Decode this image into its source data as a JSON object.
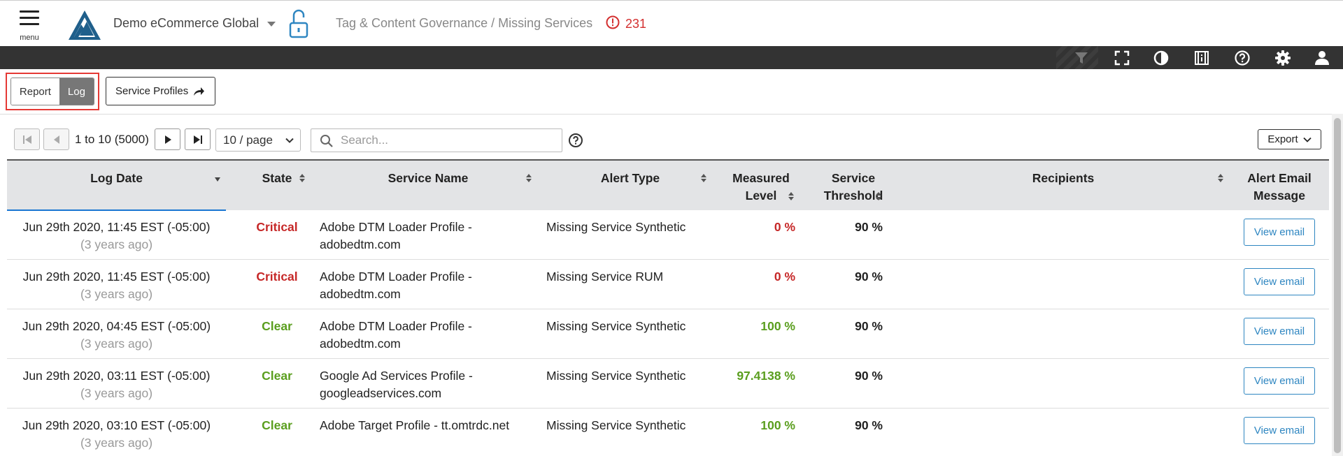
{
  "header": {
    "menu_label": "menu",
    "account_name": "Demo eCommerce Global",
    "breadcrumb": "Tag & Content Governance / Missing Services",
    "alert_count": "231"
  },
  "toolbar": {
    "icons": [
      "filter-icon",
      "fullscreen-icon",
      "contrast-icon",
      "help-manual-icon",
      "help-icon",
      "settings-icon",
      "user-icon"
    ]
  },
  "view_toggle": {
    "report_label": "Report",
    "log_label": "Log",
    "selected": "Log"
  },
  "service_profiles_label": "Service Profiles",
  "pagination": {
    "range_text": "1 to 10 (5000)",
    "per_page": "10 / page"
  },
  "search": {
    "placeholder": "Search..."
  },
  "export_label": "Export",
  "table": {
    "columns": {
      "log_date": "Log Date",
      "state": "State",
      "service_name": "Service Name",
      "alert_type": "Alert Type",
      "measured_level_1": "Measured",
      "measured_level_2": "Level",
      "service_threshold_1": "Service",
      "service_threshold_2": "Threshold",
      "recipients": "Recipients",
      "alert_email_1": "Alert Email",
      "alert_email_2": "Message"
    },
    "rows": [
      {
        "date": "Jun 29th 2020, 11:45 EST (-05:00)",
        "ago": "(3 years ago)",
        "state": "Critical",
        "name_1": "Adobe DTM Loader Profile -",
        "name_2": "adobedtm.com",
        "alert_type": "Missing Service Synthetic",
        "measured": "0 %",
        "threshold": "90 %",
        "recipients": "",
        "action": "View email"
      },
      {
        "date": "Jun 29th 2020, 11:45 EST (-05:00)",
        "ago": "(3 years ago)",
        "state": "Critical",
        "name_1": "Adobe DTM Loader Profile -",
        "name_2": "adobedtm.com",
        "alert_type": "Missing Service RUM",
        "measured": "0 %",
        "threshold": "90 %",
        "recipients": "",
        "action": "View email"
      },
      {
        "date": "Jun 29th 2020, 04:45 EST (-05:00)",
        "ago": "(3 years ago)",
        "state": "Clear",
        "name_1": "Adobe DTM Loader Profile -",
        "name_2": "adobedtm.com",
        "alert_type": "Missing Service Synthetic",
        "measured": "100 %",
        "threshold": "90 %",
        "recipients": "",
        "action": "View email"
      },
      {
        "date": "Jun 29th 2020, 03:11 EST (-05:00)",
        "ago": "(3 years ago)",
        "state": "Clear",
        "name_1": "Google Ad Services Profile -",
        "name_2": "googleadservices.com",
        "alert_type": "Missing Service Synthetic",
        "measured": "97.4138 %",
        "threshold": "90 %",
        "recipients": "",
        "action": "View email"
      },
      {
        "date": "Jun 29th 2020, 03:10 EST (-05:00)",
        "ago": "(3 years ago)",
        "state": "Clear",
        "name_1": "Adobe Target Profile - tt.omtrdc.net",
        "name_2": "",
        "alert_type": "Missing Service Synthetic",
        "measured": "100 %",
        "threshold": "90 %",
        "recipients": "",
        "action": "View email"
      }
    ]
  },
  "colors": {
    "critical": "#c62828",
    "clear": "#5a9e1e",
    "link_blue": "#2e86c1",
    "highlight_red": "#e53935",
    "toolbar_bg": "#333333"
  }
}
